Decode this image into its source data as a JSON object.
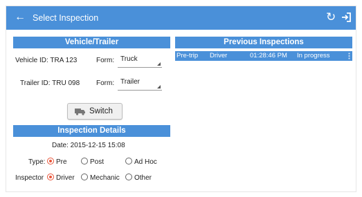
{
  "appbar": {
    "title": "Select Inspection",
    "back_icon": "arrow-left-icon",
    "refresh_icon": "refresh-icon",
    "exit_icon": "exit-icon"
  },
  "vehicle_trailer": {
    "header": "Vehicle/Trailer",
    "vehicle_id_label": "Vehicle ID: TRA 123",
    "vehicle_form_label": "Form:",
    "vehicle_form_value": "Truck",
    "trailer_id_label": "Trailer ID: TRU 098",
    "trailer_form_label": "Form:",
    "trailer_form_value": "Trailer",
    "switch_label": "Switch"
  },
  "inspection_details": {
    "header": "Inspection Details",
    "date": "Date: 2015-12-15 15:08",
    "type_label": "Type:",
    "type_options": [
      "Pre",
      "Post",
      "Ad Hoc"
    ],
    "type_selected": "Pre",
    "inspector_label": "Inspector",
    "inspector_options": [
      "Driver",
      "Mechanic",
      "Other"
    ],
    "inspector_selected": "Driver"
  },
  "previous_inspections": {
    "header": "Previous Inspections",
    "rows": [
      {
        "type": "Pre-trip",
        "inspector": "Driver",
        "time": "01:28:46 PM",
        "status": "In progress"
      }
    ]
  },
  "colors": {
    "accent": "#4a90d9",
    "radio_selected": "#e8553a"
  }
}
